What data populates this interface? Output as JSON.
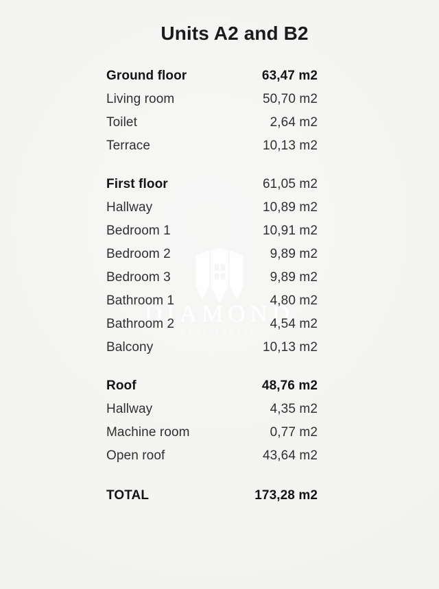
{
  "document": {
    "title": "Units A2 and B2",
    "unit_suffix": "m2"
  },
  "watermark": {
    "brand": "DIAMOND",
    "tagline": "REAL ESTATE",
    "logo_icon": "shield-building-icon"
  },
  "sections": [
    {
      "name": "ground-floor",
      "header": {
        "label": "Ground floor",
        "value": "63,47 m2",
        "value_bold": true
      },
      "rows": [
        {
          "label": "Living room",
          "value": "50,70 m2"
        },
        {
          "label": "Toilet",
          "value": "2,64 m2"
        },
        {
          "label": "Terrace",
          "value": "10,13 m2"
        }
      ]
    },
    {
      "name": "first-floor",
      "header": {
        "label": "First floor",
        "value": "61,05 m2",
        "value_bold": false
      },
      "rows": [
        {
          "label": "Hallway",
          "value": "10,89 m2"
        },
        {
          "label": "Bedroom 1",
          "value": "10,91 m2"
        },
        {
          "label": "Bedroom 2",
          "value": "9,89 m2"
        },
        {
          "label": "Bedroom 3",
          "value": "9,89 m2"
        },
        {
          "label": "Bathroom 1",
          "value": "4,80 m2"
        },
        {
          "label": "Bathroom 2",
          "value": "4,54 m2"
        },
        {
          "label": "Balcony",
          "value": "10,13 m2"
        }
      ]
    },
    {
      "name": "roof",
      "header": {
        "label": "Roof",
        "value": "48,76 m2",
        "value_bold": true
      },
      "rows": [
        {
          "label": "Hallway",
          "value": "4,35 m2"
        },
        {
          "label": "Machine room",
          "value": "0,77 m2"
        },
        {
          "label": "Open roof",
          "value": "43,64 m2"
        }
      ]
    }
  ],
  "total": {
    "label": "TOTAL",
    "value": "173,28 m2"
  },
  "colors": {
    "background": "#f4f4f2",
    "text_primary": "#141414",
    "text_secondary": "#2f2f2f",
    "watermark": "#ffffff"
  }
}
